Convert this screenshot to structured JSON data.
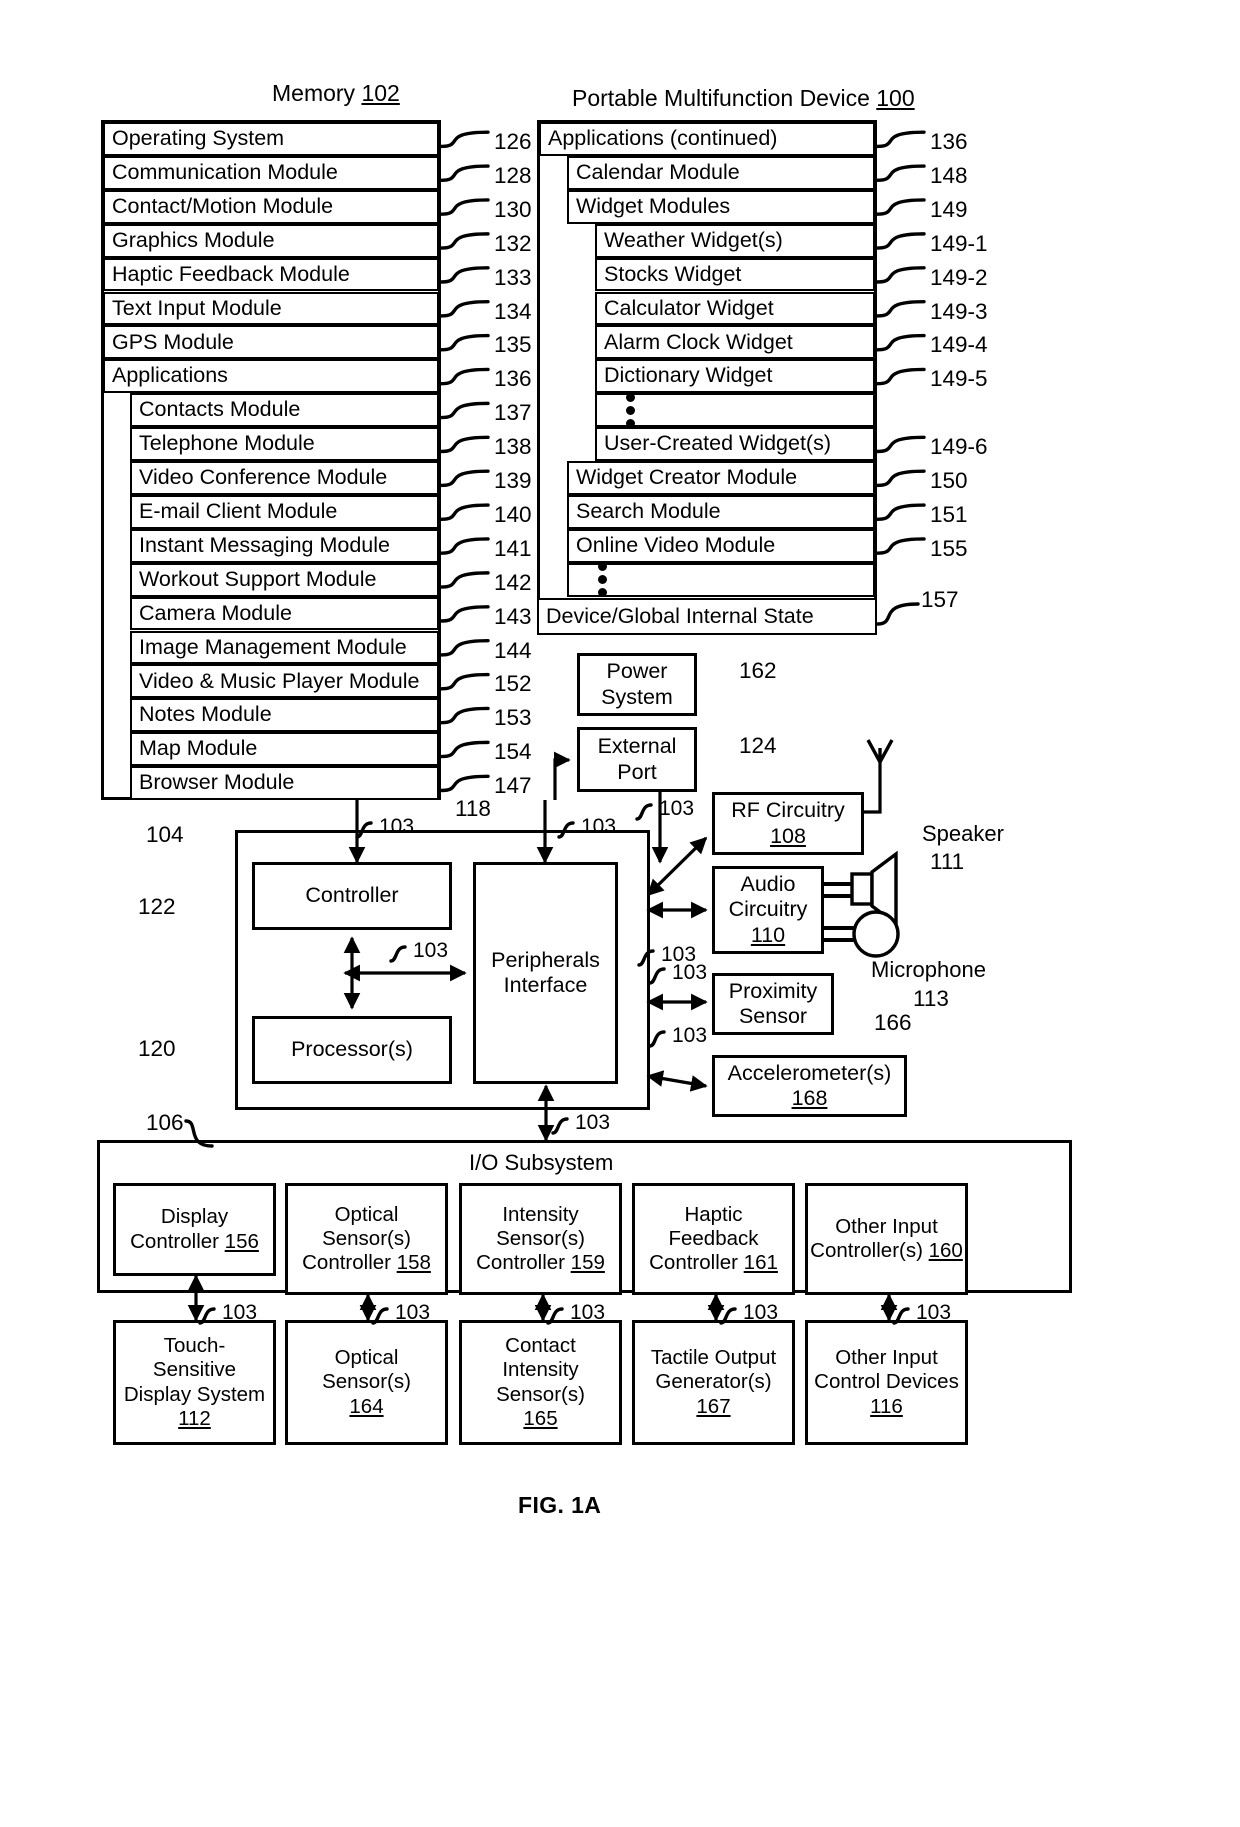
{
  "figure": {
    "caption": "FIG. 1A",
    "memory_title": "Memory",
    "memory_ref": "102",
    "device_title": "Portable Multifunction Device",
    "device_ref": "100"
  },
  "memory_list": {
    "items": [
      {
        "label": "Operating System",
        "ref": "126",
        "indent": 0
      },
      {
        "label": "Communication Module",
        "ref": "128",
        "indent": 0
      },
      {
        "label": "Contact/Motion Module",
        "ref": "130",
        "indent": 0
      },
      {
        "label": "Graphics Module",
        "ref": "132",
        "indent": 0
      },
      {
        "label": "Haptic Feedback Module",
        "ref": "133",
        "indent": 0
      },
      {
        "label": "Text Input Module",
        "ref": "134",
        "indent": 0
      },
      {
        "label": "GPS Module",
        "ref": "135",
        "indent": 0
      },
      {
        "label": "Applications",
        "ref": "136",
        "indent": 0
      },
      {
        "label": "Contacts Module",
        "ref": "137",
        "indent": 1
      },
      {
        "label": "Telephone Module",
        "ref": "138",
        "indent": 1
      },
      {
        "label": "Video Conference Module",
        "ref": "139",
        "indent": 1
      },
      {
        "label": "E-mail Client Module",
        "ref": "140",
        "indent": 1
      },
      {
        "label": "Instant Messaging Module",
        "ref": "141",
        "indent": 1
      },
      {
        "label": "Workout Support Module",
        "ref": "142",
        "indent": 1
      },
      {
        "label": "Camera Module",
        "ref": "143",
        "indent": 1
      },
      {
        "label": "Image Management Module",
        "ref": "144",
        "indent": 1
      },
      {
        "label": "Video & Music Player Module",
        "ref": "152",
        "indent": 1
      },
      {
        "label": "Notes Module",
        "ref": "153",
        "indent": 1
      },
      {
        "label": "Map Module",
        "ref": "154",
        "indent": 1
      },
      {
        "label": "Browser Module",
        "ref": "147",
        "indent": 1
      }
    ]
  },
  "apps_continued": {
    "items": [
      {
        "label": "Applications (continued)",
        "ref": "136",
        "indent": 0
      },
      {
        "label": "Calendar Module",
        "ref": "148",
        "indent": 1
      },
      {
        "label": "Widget Modules",
        "ref": "149",
        "indent": 1
      },
      {
        "label": "Weather Widget(s)",
        "ref": "149-1",
        "indent": 2
      },
      {
        "label": "Stocks Widget",
        "ref": "149-2",
        "indent": 2
      },
      {
        "label": "Calculator Widget",
        "ref": "149-3",
        "indent": 2
      },
      {
        "label": "Alarm Clock Widget",
        "ref": "149-4",
        "indent": 2
      },
      {
        "label": "Dictionary Widget",
        "ref": "149-5",
        "indent": 2
      },
      {
        "label": "",
        "ref": "",
        "indent": 2,
        "ellipsis": true
      },
      {
        "label": "User-Created Widget(s)",
        "ref": "149-6",
        "indent": 2
      },
      {
        "label": "Widget Creator Module",
        "ref": "150",
        "indent": 1
      },
      {
        "label": "Search Module",
        "ref": "151",
        "indent": 1
      },
      {
        "label": "Online Video Module",
        "ref": "155",
        "indent": 1
      },
      {
        "label": "",
        "ref": "",
        "indent": 1,
        "ellipsis": true
      }
    ],
    "device_state": {
      "label": "Device/Global Internal State",
      "ref": "157"
    }
  },
  "blocks": {
    "power_system": {
      "line1": "Power",
      "line2": "System",
      "ref": "162"
    },
    "external_port": {
      "line1": "External",
      "line2": "Port",
      "ref": "124"
    },
    "rf_circuitry": {
      "line1": "RF Circuitry",
      "num": "108"
    },
    "audio_circuitry": {
      "line1": "Audio",
      "line2": "Circuitry",
      "num": "110"
    },
    "proximity": {
      "line1": "Proximity",
      "line2": "Sensor",
      "ref": "166"
    },
    "accelerometer": {
      "line1": "Accelerometer(s)",
      "num": "168"
    },
    "controller": {
      "label": "Controller",
      "ref_a": "104",
      "ref_b": "122"
    },
    "processors": {
      "label": "Processor(s)",
      "ref": "120"
    },
    "peripherals": {
      "line1": "Peripherals",
      "line2": "Interface",
      "ref": "118"
    },
    "speaker": {
      "label": "Speaker",
      "ref": "111"
    },
    "microphone": {
      "label": "Microphone",
      "ref": "113"
    }
  },
  "io_subsystem": {
    "title": "I/O Subsystem",
    "ref": "106",
    "controllers": [
      {
        "lines": [
          "Display",
          "Controller"
        ],
        "num": "156"
      },
      {
        "lines": [
          "Optical",
          "Sensor(s)",
          "Controller"
        ],
        "num": "158"
      },
      {
        "lines": [
          "Intensity",
          "Sensor(s)",
          "Controller"
        ],
        "num": "159"
      },
      {
        "lines": [
          "Haptic",
          "Feedback",
          "Controller"
        ],
        "num": "161"
      },
      {
        "lines": [
          "Other Input",
          "Controller(s)"
        ],
        "num": "160"
      }
    ],
    "devices": [
      {
        "lines": [
          "Touch-",
          "Sensitive",
          "Display System"
        ],
        "num": "112"
      },
      {
        "lines": [
          "Optical",
          "Sensor(s)"
        ],
        "num": "164"
      },
      {
        "lines": [
          "Contact",
          "Intensity",
          "Sensor(s)"
        ],
        "num": "165"
      },
      {
        "lines": [
          "Tactile Output",
          "Generator(s)"
        ],
        "num": "167"
      },
      {
        "lines": [
          "Other Input",
          "Control Devices"
        ],
        "num": "116"
      }
    ]
  },
  "bus_labels": {
    "tag": "103",
    "occurrences": 14
  }
}
